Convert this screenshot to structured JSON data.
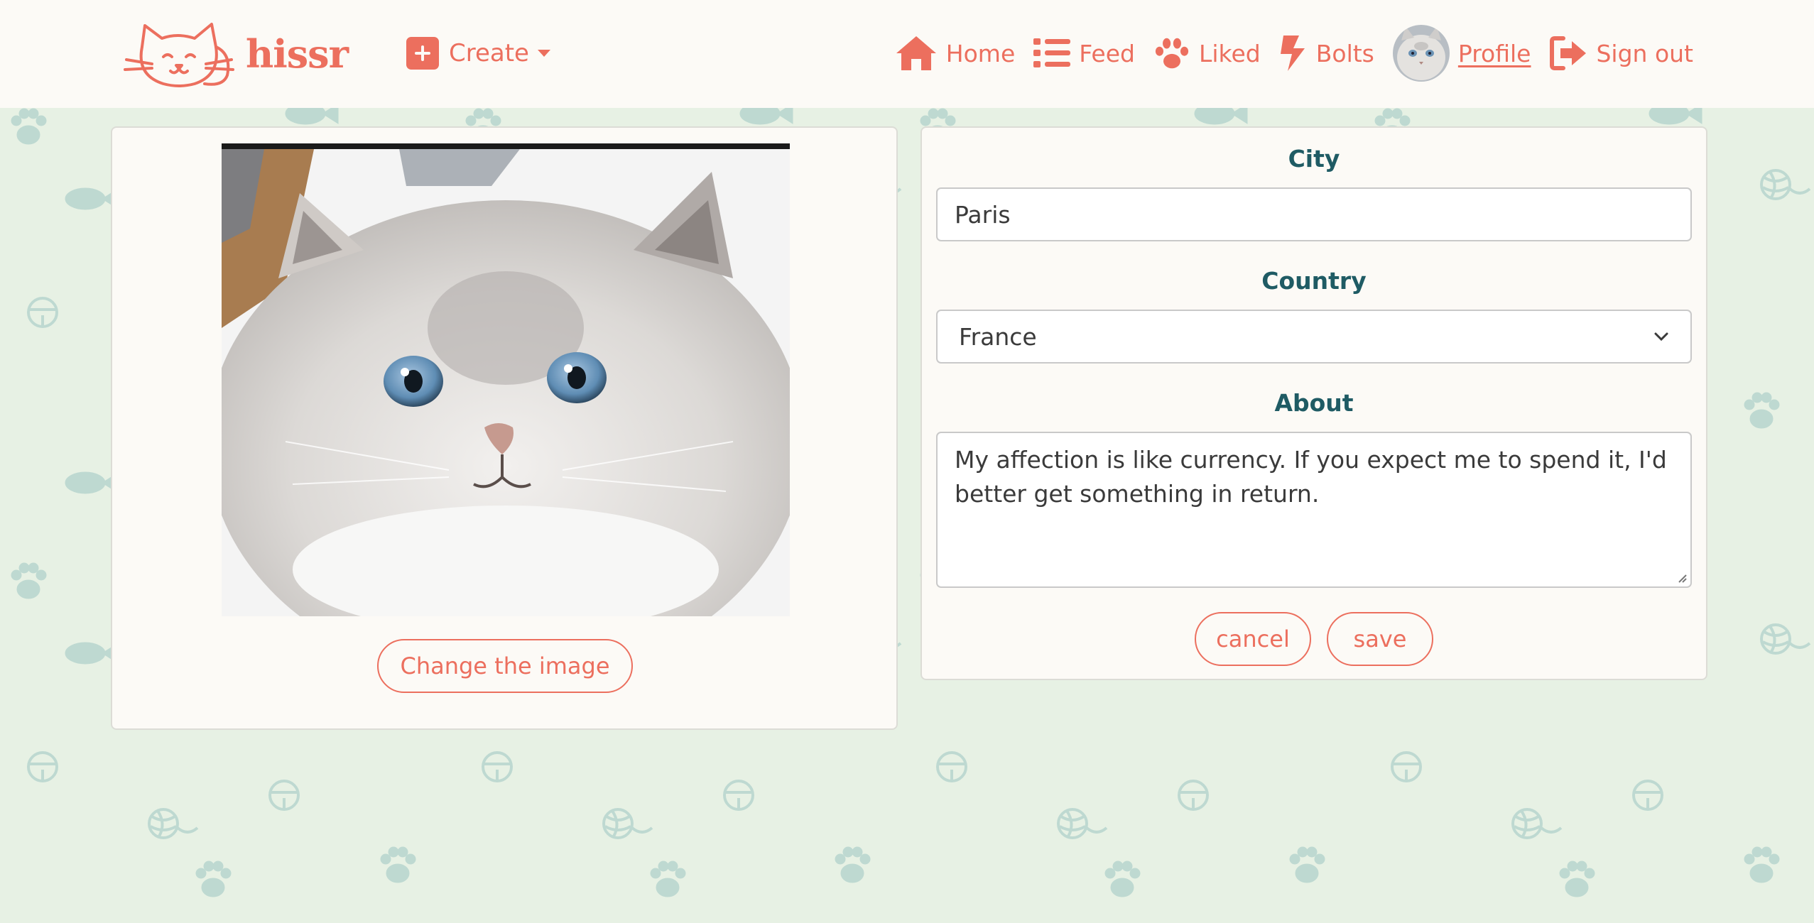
{
  "nav": {
    "brand": "hissr",
    "create": "Create",
    "links": {
      "home": "Home",
      "feed": "Feed",
      "liked": "Liked",
      "bolts": "Bolts",
      "profile": "Profile",
      "signout": "Sign out"
    }
  },
  "image_panel": {
    "change_button": "Change the image"
  },
  "form": {
    "city_label": "City",
    "city_value": "Paris",
    "country_label": "Country",
    "country_value": "France",
    "about_label": "About",
    "about_value": "My affection is like currency. If you expect me to spend it, I'd better get something in return.",
    "cancel": "cancel",
    "save": "save"
  },
  "colors": {
    "accent": "#ec6f5e",
    "label": "#1f5b64",
    "background": "#e7f1e4",
    "card": "#fcfaf6"
  },
  "icons": [
    "cat-logo-icon",
    "plus-square-icon",
    "home-icon",
    "list-icon",
    "paw-icon",
    "bolt-icon",
    "sign-out-icon",
    "chevron-down-icon"
  ]
}
